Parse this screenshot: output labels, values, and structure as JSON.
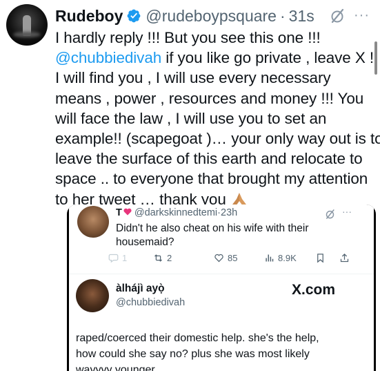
{
  "tweet": {
    "name": "Rudeboy",
    "handle": "@rudeboypsquare",
    "separator": "·",
    "time": "31s",
    "more": "···",
    "lines": [
      "I hardly reply !!! But you see this one !!!",
      " if you like go private , leave X !!",
      "I will find you , I will use every necessary",
      "means , power , resources and money !!!  You",
      "will face the law , I will use you to set an",
      "example!! (scapegoat )… your only way out is to",
      "leave the surface of this earth and relocate to",
      "space .. to everyone that brought my attention",
      "to her tweet … thank you "
    ],
    "mention": "@chubbiedivah",
    "emoji": "folded-hands-emoji"
  },
  "quote1": {
    "name": "T",
    "handle": "@darkskinnedtemi",
    "separator": "·",
    "time": "23h",
    "more": "···",
    "text_lines": [
      "Didn't he also cheat on his wife with their",
      "housemaid?"
    ],
    "actions": {
      "replies": "1",
      "reposts": "2",
      "likes": "85",
      "views": "8.9K"
    }
  },
  "quote2": {
    "name": "àlhájì ayọ̀",
    "handle": "@chubbiedivah",
    "brand": "X.com",
    "text_lines": [
      "raped/coerced their domestic help. she's the help,",
      "how could she say no? plus she was most likely",
      "wayyyy younger"
    ]
  },
  "colors": {
    "accent": "#1d9bf0",
    "text": "#0f1419",
    "muted": "#536471"
  }
}
